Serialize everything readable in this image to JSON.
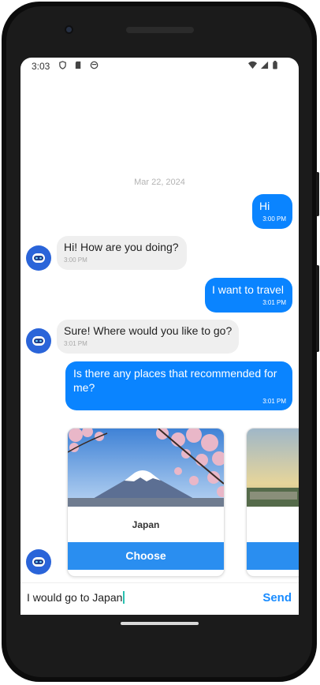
{
  "status_bar": {
    "time": "3:03"
  },
  "chat": {
    "date": "Mar 22, 2024",
    "messages": [
      {
        "from": "user",
        "text": "Hi",
        "time": "3:00 PM"
      },
      {
        "from": "bot",
        "text": "Hi! How are you doing?",
        "time": "3:00 PM"
      },
      {
        "from": "user",
        "text": "I want to travel",
        "time": "3:01 PM"
      },
      {
        "from": "bot",
        "text": "Sure! Where would you like to go?",
        "time": "3:01 PM"
      },
      {
        "from": "user",
        "text": "Is there any places that recommended for me?",
        "time": "3:01 PM"
      }
    ]
  },
  "cards": [
    {
      "name": "Japan",
      "button": "Choose"
    },
    {
      "name": "",
      "button": ""
    }
  ],
  "composer": {
    "value": "I would go to Japan",
    "send_label": "Send"
  },
  "colors": {
    "accent": "#0a84ff",
    "choose_button": "#2a8ef0",
    "avatar": "#2a64d9",
    "bot_bubble": "#efefef"
  }
}
